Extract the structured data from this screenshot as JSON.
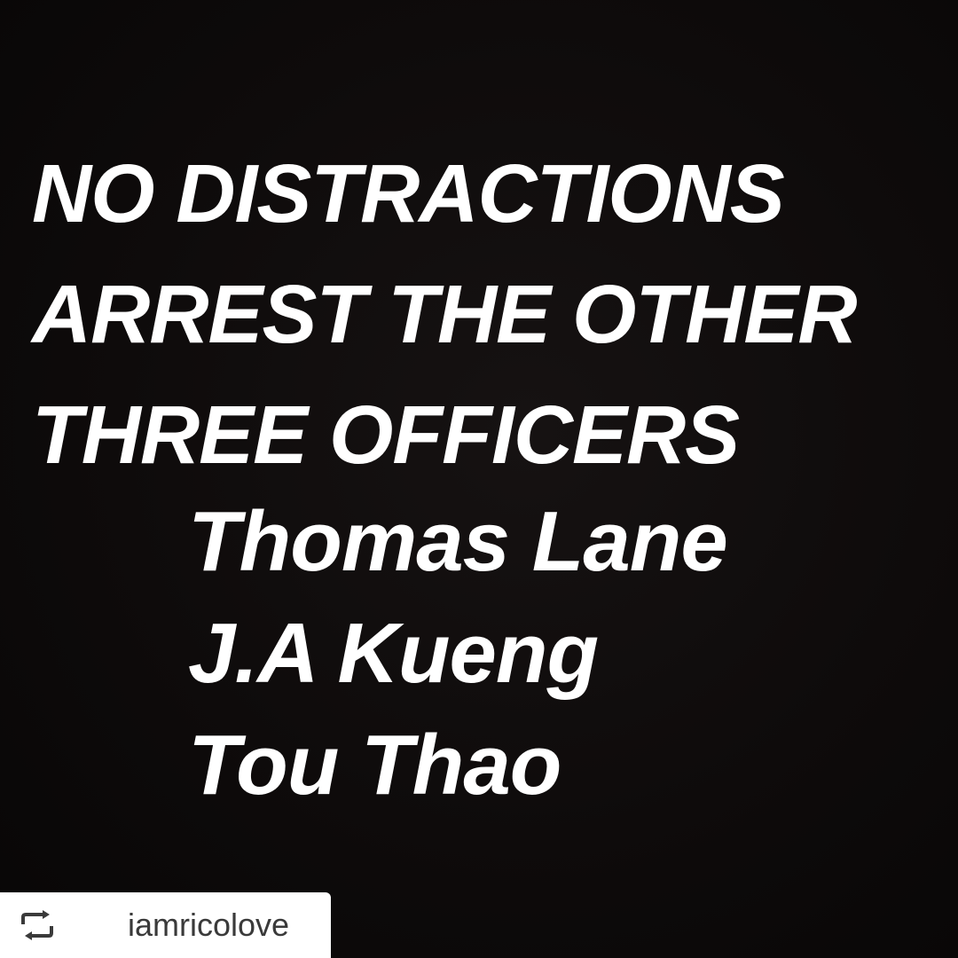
{
  "headline": {
    "lines": [
      "NO DISTRACTIONS",
      "ARREST THE OTHER",
      "THREE OFFICERS"
    ]
  },
  "names": {
    "lines": [
      "Thomas Lane",
      "J.A Kueng",
      "Tou Thao"
    ]
  },
  "repost": {
    "icon": "repost-icon",
    "handle": "iamricolove"
  },
  "colors": {
    "background": "#0c0a0a",
    "text": "#ffffff",
    "badge_background": "#ffffff",
    "badge_text": "#3a3a3a"
  }
}
